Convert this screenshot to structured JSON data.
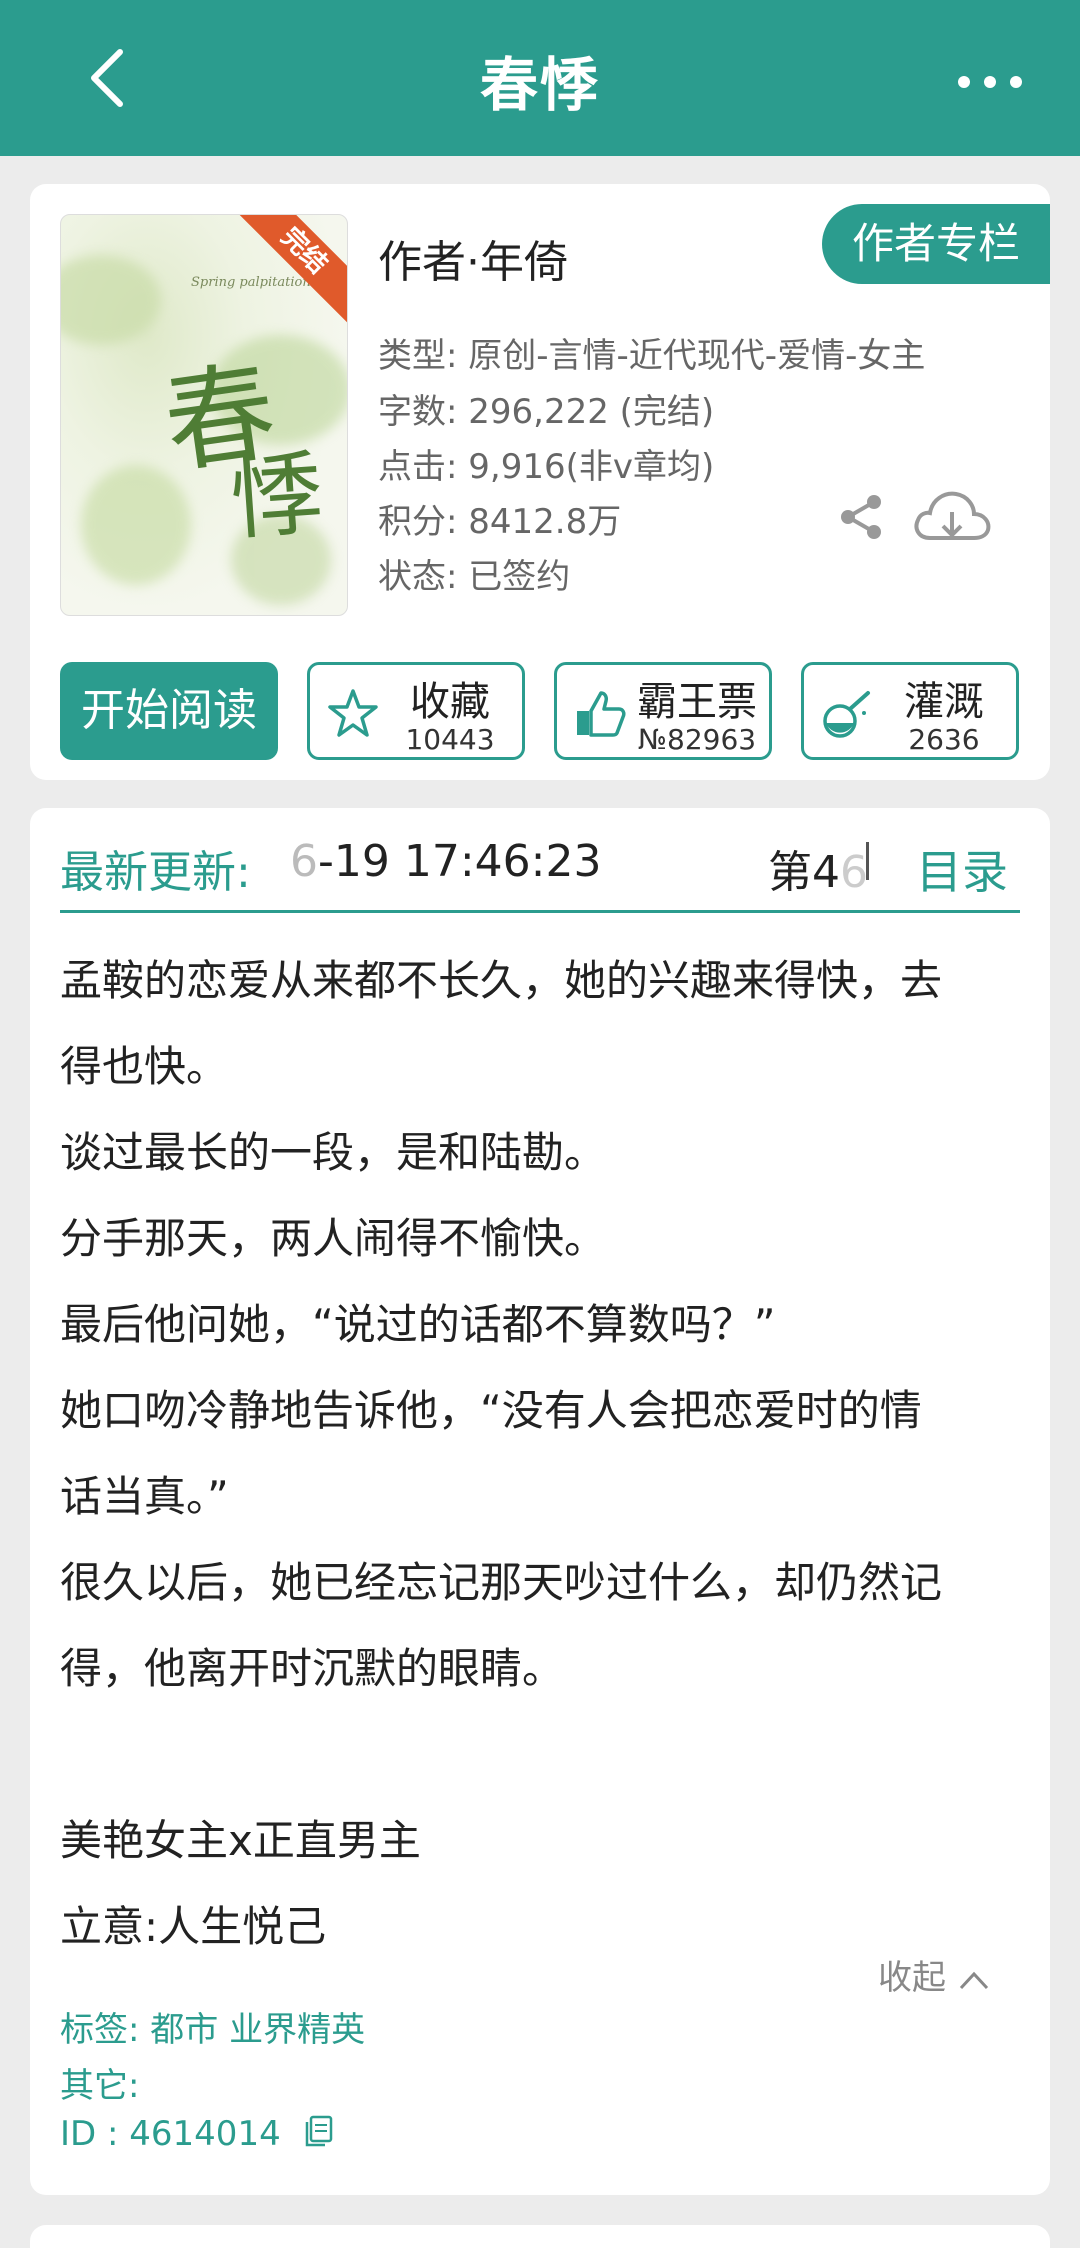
{
  "header": {
    "title": "春悸",
    "back_icon": "chevron-left-icon",
    "more_icon": "more-dots-icon"
  },
  "book": {
    "cover_subtitle": "Spring palpitation",
    "cover_title_1": "春",
    "cover_title_2": "悸",
    "cover_badge": "完结",
    "author_label": "作者·年倚",
    "author_column_button": "作者专栏",
    "type_key": "类型: ",
    "type_value": "原创-言情-近代现代-爱情-女主",
    "words_key": "字数: ",
    "words_value": "296,222 (完结)",
    "clicks_key": "点击: ",
    "clicks_value": "9,916(非v章均)",
    "score_key": "积分: ",
    "score_value": "8412.8万",
    "status_key": "状态: ",
    "status_value": "已签约"
  },
  "actions": {
    "start_read": "开始阅读",
    "favorite_label": "收藏",
    "favorite_count": "10443",
    "ticket_label": "霸王票",
    "ticket_rank": "№82963",
    "water_label": "灌溉",
    "water_count": "2636"
  },
  "update": {
    "label": "最新更新:",
    "time_faded": "6",
    "time": "-19 17:46:23",
    "chapter_prefix": "第4",
    "chapter_faded": "6",
    "toc_button": "目录"
  },
  "intro": {
    "lines": [
      "孟鞍的恋爱从来都不长久，她的兴趣来得快，去",
      "得也快。",
      "谈过最长的一段，是和陆勘。",
      "分手那天，两人闹得不愉快。",
      "最后他问她，“说过的话都不算数吗？”",
      "她口吻冷静地告诉他，“没有人会把恋爱时的情",
      "话当真。”",
      "很久以后，她已经忘记那天吵过什么，却仍然记",
      "得，他离开时沉默的眼睛。",
      "",
      "美艳女主x正直男主",
      "立意:人生悦己"
    ],
    "collapse_button": "收起"
  },
  "meta": {
    "tags_key": "标签: ",
    "tags_value": "都市 业界精英",
    "other_key": "其它: ",
    "id_key": "ID    : ",
    "id_value": "4614014"
  },
  "colors": {
    "accent": "#2b9c8e",
    "badge": "#e05a2b",
    "background": "#ececec"
  }
}
